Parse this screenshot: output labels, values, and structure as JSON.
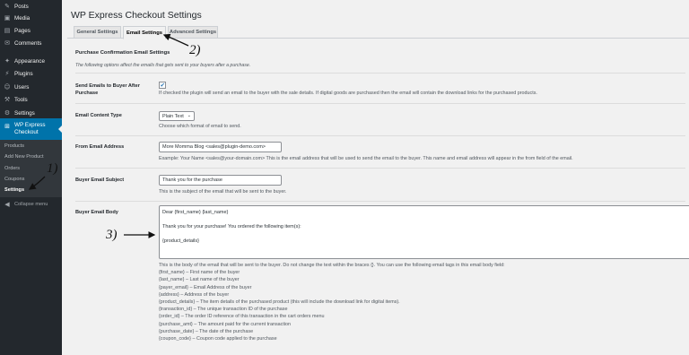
{
  "sidebar": {
    "items": [
      {
        "label": "Posts",
        "icon": "pushpin-icon",
        "glyph": "✎"
      },
      {
        "label": "Media",
        "icon": "media-icon",
        "glyph": "▣"
      },
      {
        "label": "Pages",
        "icon": "pages-icon",
        "glyph": "▤"
      },
      {
        "label": "Comments",
        "icon": "comments-icon",
        "glyph": "✉"
      },
      {
        "label": "Appearance",
        "icon": "appearance-icon",
        "glyph": "✦"
      },
      {
        "label": "Plugins",
        "icon": "plugins-icon",
        "glyph": "⚡"
      },
      {
        "label": "Users",
        "icon": "users-icon",
        "glyph": "☺"
      },
      {
        "label": "Tools",
        "icon": "tools-icon",
        "glyph": "⚒"
      },
      {
        "label": "Settings",
        "icon": "settings-icon",
        "glyph": "⚙"
      }
    ],
    "active": {
      "line1": "WP Express",
      "line2": "Checkout",
      "glyph": "⊞"
    },
    "submenu": [
      "Products",
      "Add New Product",
      "Orders",
      "Coupons",
      "Settings"
    ],
    "collapse": {
      "label": "Collapse menu",
      "glyph": "◀"
    }
  },
  "page": {
    "title": "WP Express Checkout Settings",
    "tabs": [
      "General Settings",
      "Email Settings",
      "Advanced Settings"
    ],
    "section_title": "Purchase Confirmation Email Settings",
    "section_desc": "The following options affect the emails that gets sent to your buyers after a purchase."
  },
  "fields": {
    "send_emails": {
      "label_line1": "Send Emails to Buyer After",
      "label_line2": "Purchase",
      "desc": "If checked the plugin will send an email to the buyer with the sale details. If digital goods are purchased then the email will contain the download links for the purchased products."
    },
    "content_type": {
      "label": "Email Content Type",
      "value": "Plain Text",
      "desc": "Choose which format of email to send."
    },
    "from_address": {
      "label": "From Email Address",
      "value": "More Momma Blog <sales@plugin-demo.com>",
      "desc": "Example: Your Name <sales@your-domain.com> This is the email address that will be used to send the email to the buyer. This name and email address will appear in the from field of the email."
    },
    "subject": {
      "label": "Buyer Email Subject",
      "value": "Thank you for the purchase",
      "desc": "This is the subject of the email that will be sent to the buyer."
    },
    "body": {
      "label": "Buyer Email Body",
      "lines": [
        "Dear {first_name} {last_name}",
        "Thank you for your purchase! You ordered the following item(s):",
        "{product_details}"
      ],
      "desc": "This is the body of the email that will be sent to the buyer. Do not change the text within the braces {}. You can use the following email tags in this email body field:",
      "tags": [
        "{first_name} – First name of the buyer",
        "{last_name} – Last name of the buyer",
        "{payer_email} – Email Address of the buyer",
        "{address} – Address of the buyer",
        "{product_details} – The item details of the purchased product (this will include the download link for digital items).",
        "{transaction_id} – The unique transaction ID of the purchase",
        "{order_id} – The order ID reference of this transaction in the cart orders menu",
        "{purchase_amt} – The amount paid for the current transaction",
        "{purchase_date} – The date of the purchase",
        "{coupon_code} – Coupon code applied to the purchase"
      ]
    }
  },
  "annotations": {
    "a1": "1)",
    "a2": "2)",
    "a3": "3)"
  },
  "colors": {
    "sidebar_bg": "#23282d",
    "accent": "#0073aa",
    "page_bg": "#f1f1f1"
  }
}
